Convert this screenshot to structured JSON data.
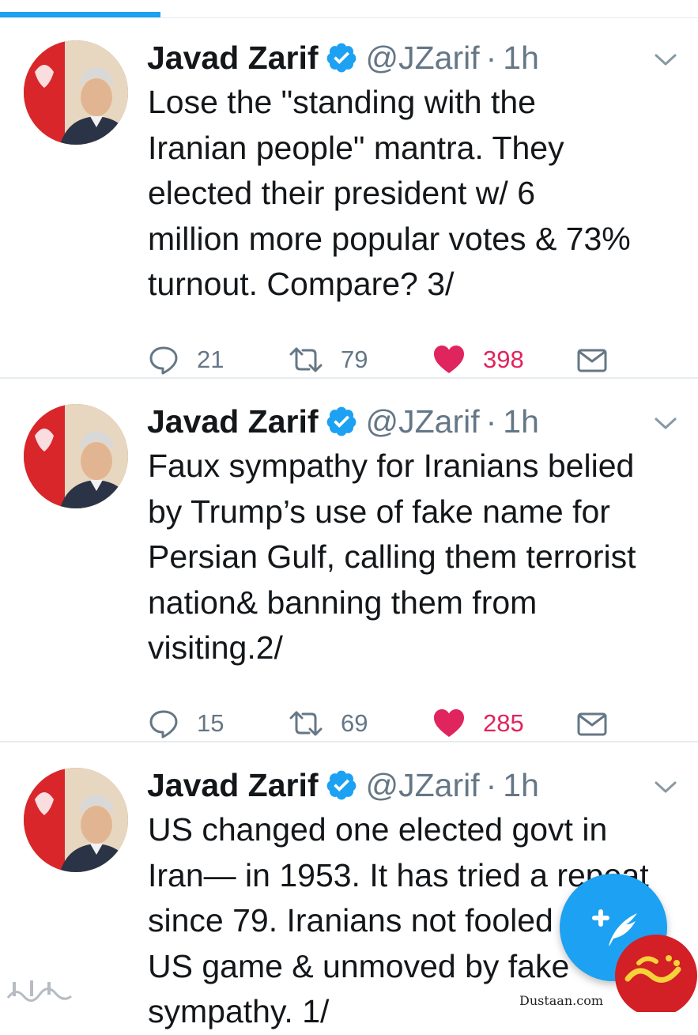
{
  "colors": {
    "accent": "#1da1f2",
    "like": "#e0245e",
    "muted": "#657786",
    "text": "#14171a",
    "divider": "#e6ecf0"
  },
  "icons": {
    "verified": "verified-badge-icon",
    "caret": "chevron-down-icon",
    "reply": "reply-bubble-icon",
    "retweet": "retweet-icon",
    "like": "heart-icon",
    "dm": "envelope-icon",
    "compose": "compose-tweet-icon"
  },
  "tweets": [
    {
      "name": "Javad Zarif",
      "handle": "@JZarif",
      "separator": "·",
      "time": "1h",
      "lines": [
        "Lose the \"standing with the",
        "Iranian people\" mantra. They",
        "elected their president w/ 6",
        "million more popular votes & 73%",
        "turnout. Compare? 3/"
      ],
      "replies": "21",
      "retweets": "79",
      "likes": "398",
      "liked": true
    },
    {
      "name": "Javad Zarif",
      "handle": "@JZarif",
      "separator": "·",
      "time": "1h",
      "lines": [
        "Faux sympathy for Iranians belied",
        "by Trump’s use of fake name for",
        "Persian Gulf, calling them terrorist",
        "nation& banning them from",
        "visiting.2/"
      ],
      "replies": "15",
      "retweets": "69",
      "likes": "285",
      "liked": true
    },
    {
      "name": "Javad Zarif",
      "handle": "@JZarif",
      "separator": "·",
      "time": "1h",
      "lines": [
        "US changed one elected govt in",
        "Iran— in 1953. It has tried a repeat",
        "since 79. Iranians not fooled by",
        "US game & unmoved by fake",
        "sympathy. 1/"
      ]
    }
  ],
  "watermark": {
    "url": "Dustaan.com"
  }
}
